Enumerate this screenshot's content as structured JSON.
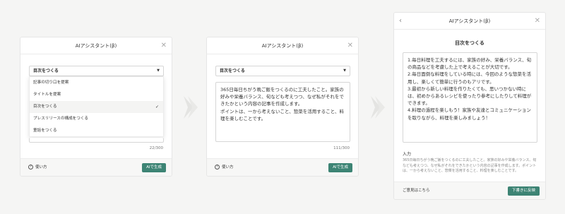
{
  "assistant_title": "AIアシスタント(β)",
  "panel1": {
    "select_value": "目次をつくる",
    "options": [
      {
        "label": "記事の切り口を提案",
        "selected": false
      },
      {
        "label": "タイトルを提案",
        "selected": false
      },
      {
        "label": "目次をつくる",
        "selected": true
      },
      {
        "label": "プレスリリースの構成をつくる",
        "selected": false
      },
      {
        "label": "童話をつくる",
        "selected": false
      }
    ],
    "counter": "22/300",
    "help_label": "使い方",
    "generate_label": "AIで生成"
  },
  "panel2": {
    "select_value": "目次をつくる",
    "text": "365日毎日ちがう晩ご飯をつくるのに工夫したこと。家族の好みや栄養バランス、旬なども考えつつ、なぜ私がそれをできたかという内容の記事を作成します。\nポイントは、一から考えないこと、惣菜を活用すること、料理を楽しむことです。",
    "counter": "111/300",
    "help_label": "使い方",
    "generate_label": "AIで生成"
  },
  "panel3": {
    "heading": "目次をつくる",
    "result": "1.毎日料理を工夫するには、家族の好み、栄養バランス、旬の商品などを考慮した上で考えることが大切です。\n2.毎日面倒な料理をしている時には、今回のような惣菜を活用し、楽しくて簡単に行うのもアリです。\n3.最初から新しい料理を作りたくても、思いつかない時には、初めからあるレシピを使ったり参考にしたりして料理ができます。\n4.料理の過程を楽しもう！家族や友達とコミュニケーションを取りながら、料理を楽しみましょう！",
    "input_label": "入力",
    "input_text": "365日毎日ちがう晩ご飯をつくるのに工夫したこと。家族の好みや栄養バランス、旬なども考えつつ、なぜ私がそれをできたかという内容の記事を作成します。ポイントは、一から考えないこと、惣菜を活用すること、料理を楽しむことです。",
    "feedback_label": "ご意見はこちら",
    "insert_label": "下書きに反映"
  },
  "colors": {
    "accent": "#3d8474",
    "background": "#f5f5f4"
  },
  "icons": {
    "close": "close-icon",
    "back": "back-arrow-icon",
    "help": "help-icon",
    "chevron": "chevron-down-icon",
    "check": "check-icon",
    "flow": "flow-arrow-icon"
  }
}
